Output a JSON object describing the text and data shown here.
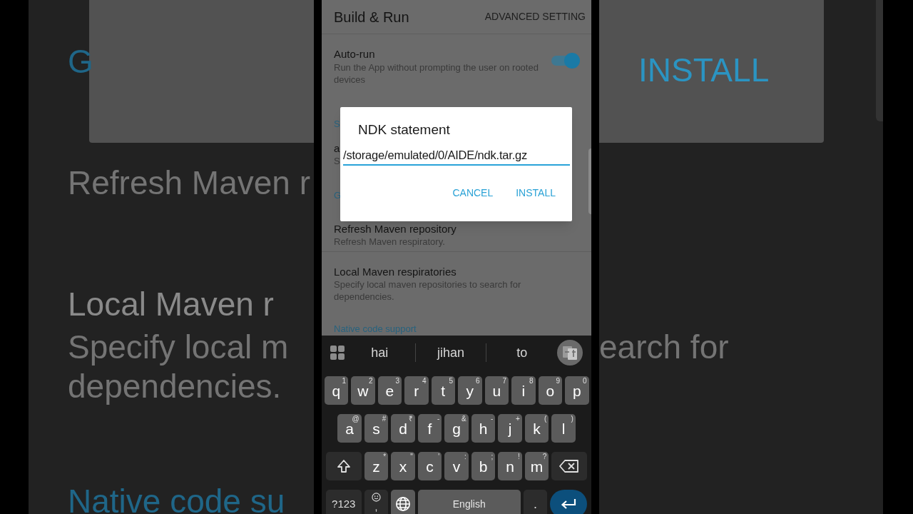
{
  "background": {
    "left": [
      {
        "kind": "section",
        "text": "G"
      },
      {
        "kind": "summary",
        "text": "Refresh Maven r"
      },
      {
        "kind": "title",
        "text": "Local Maven r"
      },
      {
        "kind": "summary",
        "text": "Specify local m"
      },
      {
        "kind": "summary",
        "text": "dependencies."
      },
      {
        "kind": "section",
        "text": "Native code su"
      }
    ],
    "right": [
      {
        "kind": "button",
        "text": "INSTALL"
      },
      {
        "kind": "summary",
        "text": "earch for"
      }
    ]
  },
  "app_bar": {
    "title": "Build & Run",
    "action": "ADVANCED SETTING"
  },
  "settings": [
    {
      "kind": "toggle",
      "title": "Auto-run",
      "summary": "Run the App without prompting the user on rooted devices",
      "on": true
    },
    {
      "kind": "section",
      "title": "S"
    },
    {
      "kind": "item",
      "title": "a",
      "summary": "S"
    },
    {
      "kind": "section",
      "title": "G"
    },
    {
      "kind": "item",
      "title": "Refresh Maven repository",
      "summary": "Refresh Maven respiratory."
    },
    {
      "kind": "item",
      "title": "Local Maven respiratories",
      "summary": "Specify local maven repositories to search for dependencies."
    },
    {
      "kind": "section",
      "title": "Native code support"
    }
  ],
  "dialog": {
    "title": "NDK statement",
    "value": "/storage/emulated/0/AIDE/ndk.tar.gz",
    "buttons": [
      "CANCEL",
      "INSTALL"
    ]
  },
  "keyboard": {
    "suggestions": [
      "hai",
      "jihan",
      "to"
    ],
    "rows": [
      [
        {
          "key": "q",
          "hint": "1"
        },
        {
          "key": "w",
          "hint": "2"
        },
        {
          "key": "e",
          "hint": "3"
        },
        {
          "key": "r",
          "hint": "4"
        },
        {
          "key": "t",
          "hint": "5"
        },
        {
          "key": "y",
          "hint": "6"
        },
        {
          "key": "u",
          "hint": "7"
        },
        {
          "key": "i",
          "hint": "8"
        },
        {
          "key": "o",
          "hint": "9"
        },
        {
          "key": "p",
          "hint": "0"
        }
      ],
      [
        {
          "key": "a",
          "hint": "@"
        },
        {
          "key": "s",
          "hint": "#"
        },
        {
          "key": "d",
          "hint": "₹"
        },
        {
          "key": "f",
          "hint": "-"
        },
        {
          "key": "g",
          "hint": "&"
        },
        {
          "key": "h",
          "hint": "-"
        },
        {
          "key": "j",
          "hint": "+"
        },
        {
          "key": "k",
          "hint": "("
        },
        {
          "key": "l",
          "hint": ")"
        }
      ],
      [
        {
          "key": "z",
          "hint": "*"
        },
        {
          "key": "x",
          "hint": "\""
        },
        {
          "key": "c",
          "hint": "'"
        },
        {
          "key": "v",
          "hint": ":"
        },
        {
          "key": "b",
          "hint": ";"
        },
        {
          "key": "n",
          "hint": "!"
        },
        {
          "key": "m",
          "hint": "?"
        }
      ]
    ],
    "symbols": "?123",
    "comma": ",",
    "space": "English",
    "period": "."
  }
}
